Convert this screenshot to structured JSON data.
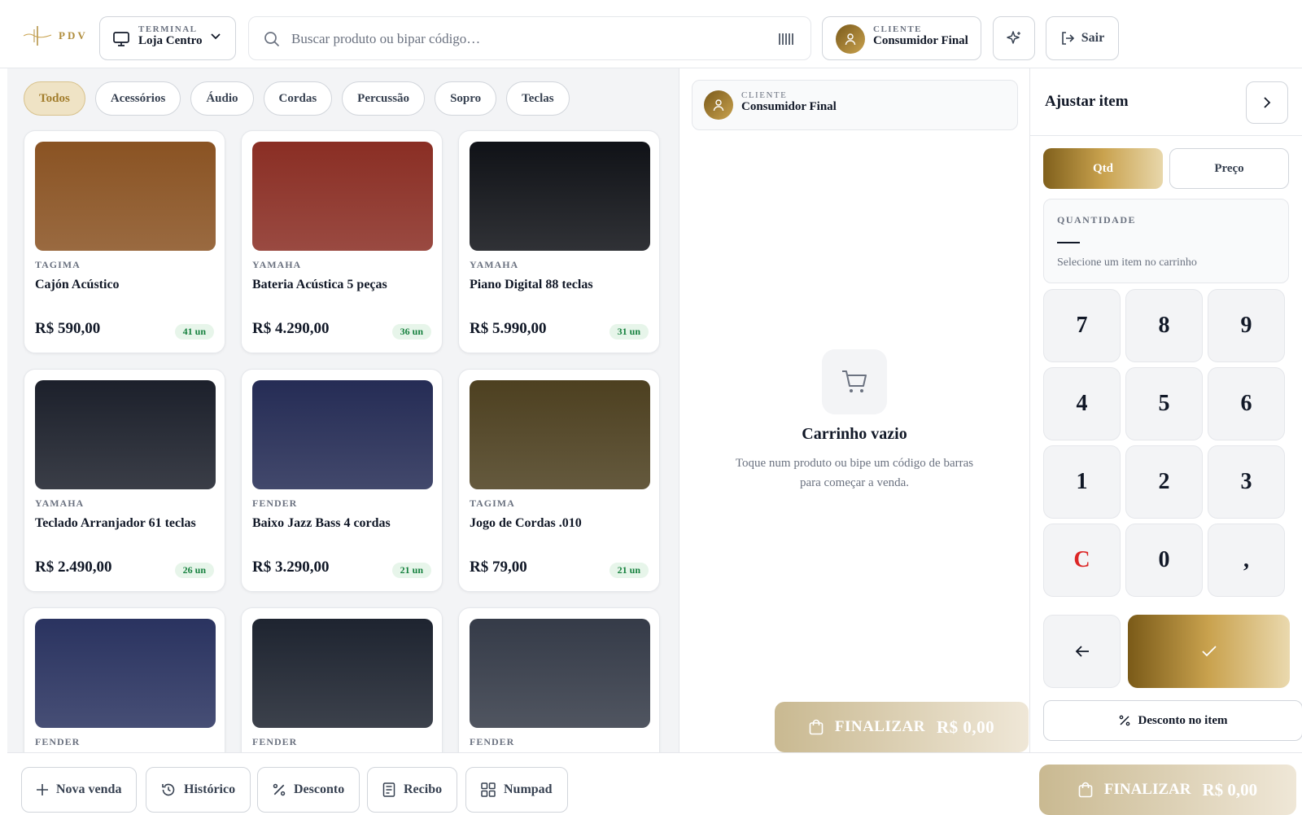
{
  "app": {
    "logo_text": "PDV"
  },
  "colors": {
    "accent": "#b08d3c",
    "stock_green": "#15803d",
    "clear_red": "#dc2626"
  },
  "terminal": {
    "label": "TERMINAL",
    "value": "Loja Centro"
  },
  "search": {
    "placeholder": "Buscar produto ou bipar código…",
    "value": ""
  },
  "client": {
    "label": "CLIENTE",
    "name": "Consumidor Final"
  },
  "header": {
    "logout_label": "Sair"
  },
  "categories": [
    "Todos",
    "Acessórios",
    "Áudio",
    "Cordas",
    "Percussão",
    "Sopro",
    "Teclas"
  ],
  "active_category": "Todos",
  "products": [
    {
      "brand": "TAGIMA",
      "name": "Cajón Acústico",
      "price": "R$ 590,00",
      "stock": "41 un",
      "color": "#8a5323"
    },
    {
      "brand": "YAMAHA",
      "name": "Bateria Acústica 5 peças",
      "price": "R$ 4.290,00",
      "stock": "36 un",
      "color": "#8a2e24"
    },
    {
      "brand": "YAMAHA",
      "name": "Piano Digital 88 teclas",
      "price": "R$ 5.990,00",
      "stock": "31 un",
      "color": "#101217"
    },
    {
      "brand": "YAMAHA",
      "name": "Teclado Arranjador 61 teclas",
      "price": "R$ 2.490,00",
      "stock": "26 un",
      "color": "#1c202b"
    },
    {
      "brand": "FENDER",
      "name": "Baixo Jazz Bass 4 cordas",
      "price": "R$ 3.290,00",
      "stock": "21 un",
      "color": "#252c55"
    },
    {
      "brand": "TAGIMA",
      "name": "Jogo de Cordas .010",
      "price": "R$ 79,00",
      "stock": "21 un",
      "color": "#4d4020"
    },
    {
      "brand": "FENDER",
      "name": "",
      "price": "",
      "stock": "",
      "color": "#2a3360"
    },
    {
      "brand": "FENDER",
      "name": "",
      "price": "",
      "stock": "",
      "color": "#1e2430"
    },
    {
      "brand": "FENDER",
      "name": "",
      "price": "",
      "stock": "",
      "color": "#353b48"
    }
  ],
  "cart": {
    "empty_title": "Carrinho vazio",
    "empty_subtitle": "Toque num produto ou bipe um código de barras para começar a venda.",
    "finalize_label": "FINALIZAR",
    "total": "R$ 0,00"
  },
  "adjust": {
    "title": "Ajustar item",
    "tab_qty": "Qtd",
    "tab_price": "Preço",
    "qty_label": "QUANTIDADE",
    "qty_hint": "Selecione um item no carrinho",
    "keys": [
      "7",
      "8",
      "9",
      "4",
      "5",
      "6",
      "1",
      "2",
      "3",
      "C",
      "0",
      ","
    ],
    "item_discount_label": "Desconto no item"
  },
  "bottom": {
    "new_sale": "Nova venda",
    "history": "Histórico",
    "discount": "Desconto",
    "receipt": "Recibo",
    "numpad": "Numpad",
    "finalize_label": "FINALIZAR",
    "total": "R$ 0,00"
  }
}
